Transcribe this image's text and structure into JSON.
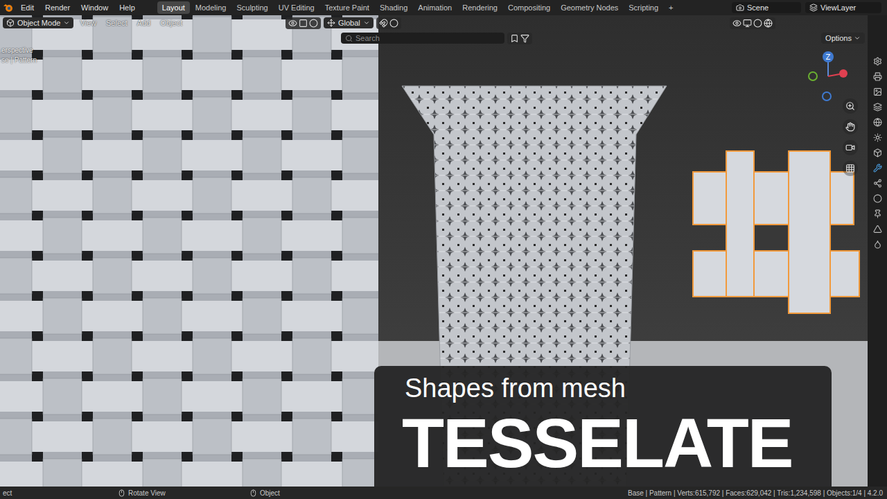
{
  "menubar": {
    "menus": [
      "Edit",
      "Render",
      "Window",
      "Help"
    ],
    "workspaces": [
      {
        "label": "Layout",
        "selected": true
      },
      {
        "label": "Modeling",
        "selected": false
      },
      {
        "label": "Sculpting",
        "selected": false
      },
      {
        "label": "UV Editing",
        "selected": false
      },
      {
        "label": "Texture Paint",
        "selected": false
      },
      {
        "label": "Shading",
        "selected": false
      },
      {
        "label": "Animation",
        "selected": false
      },
      {
        "label": "Rendering",
        "selected": false
      },
      {
        "label": "Compositing",
        "selected": false
      },
      {
        "label": "Geometry Nodes",
        "selected": false
      },
      {
        "label": "Scripting",
        "selected": false
      }
    ],
    "add_tab": "+",
    "scene": "Scene",
    "view_layer": "ViewLayer"
  },
  "viewport_header": {
    "mode": "Object Mode",
    "menus": [
      "View",
      "Select",
      "Add",
      "Object"
    ],
    "orientation": "Global"
  },
  "tool_settings": {
    "search_placeholder": "Search",
    "options": "Options"
  },
  "viewport": {
    "view_name": "erspective",
    "collection": "se | Pattern",
    "gizmo_label": "Z"
  },
  "thumbnail": {
    "subtitle": "Shapes from mesh",
    "title": "TESSELATE"
  },
  "status_bar": {
    "items": [
      "ect",
      "Rotate View",
      "Object"
    ],
    "stats": "Base | Pattern | Verts:615,792 | Faces:629,042 | Tris:1,234,598 | Objects:1/4 | 4.2.0"
  }
}
